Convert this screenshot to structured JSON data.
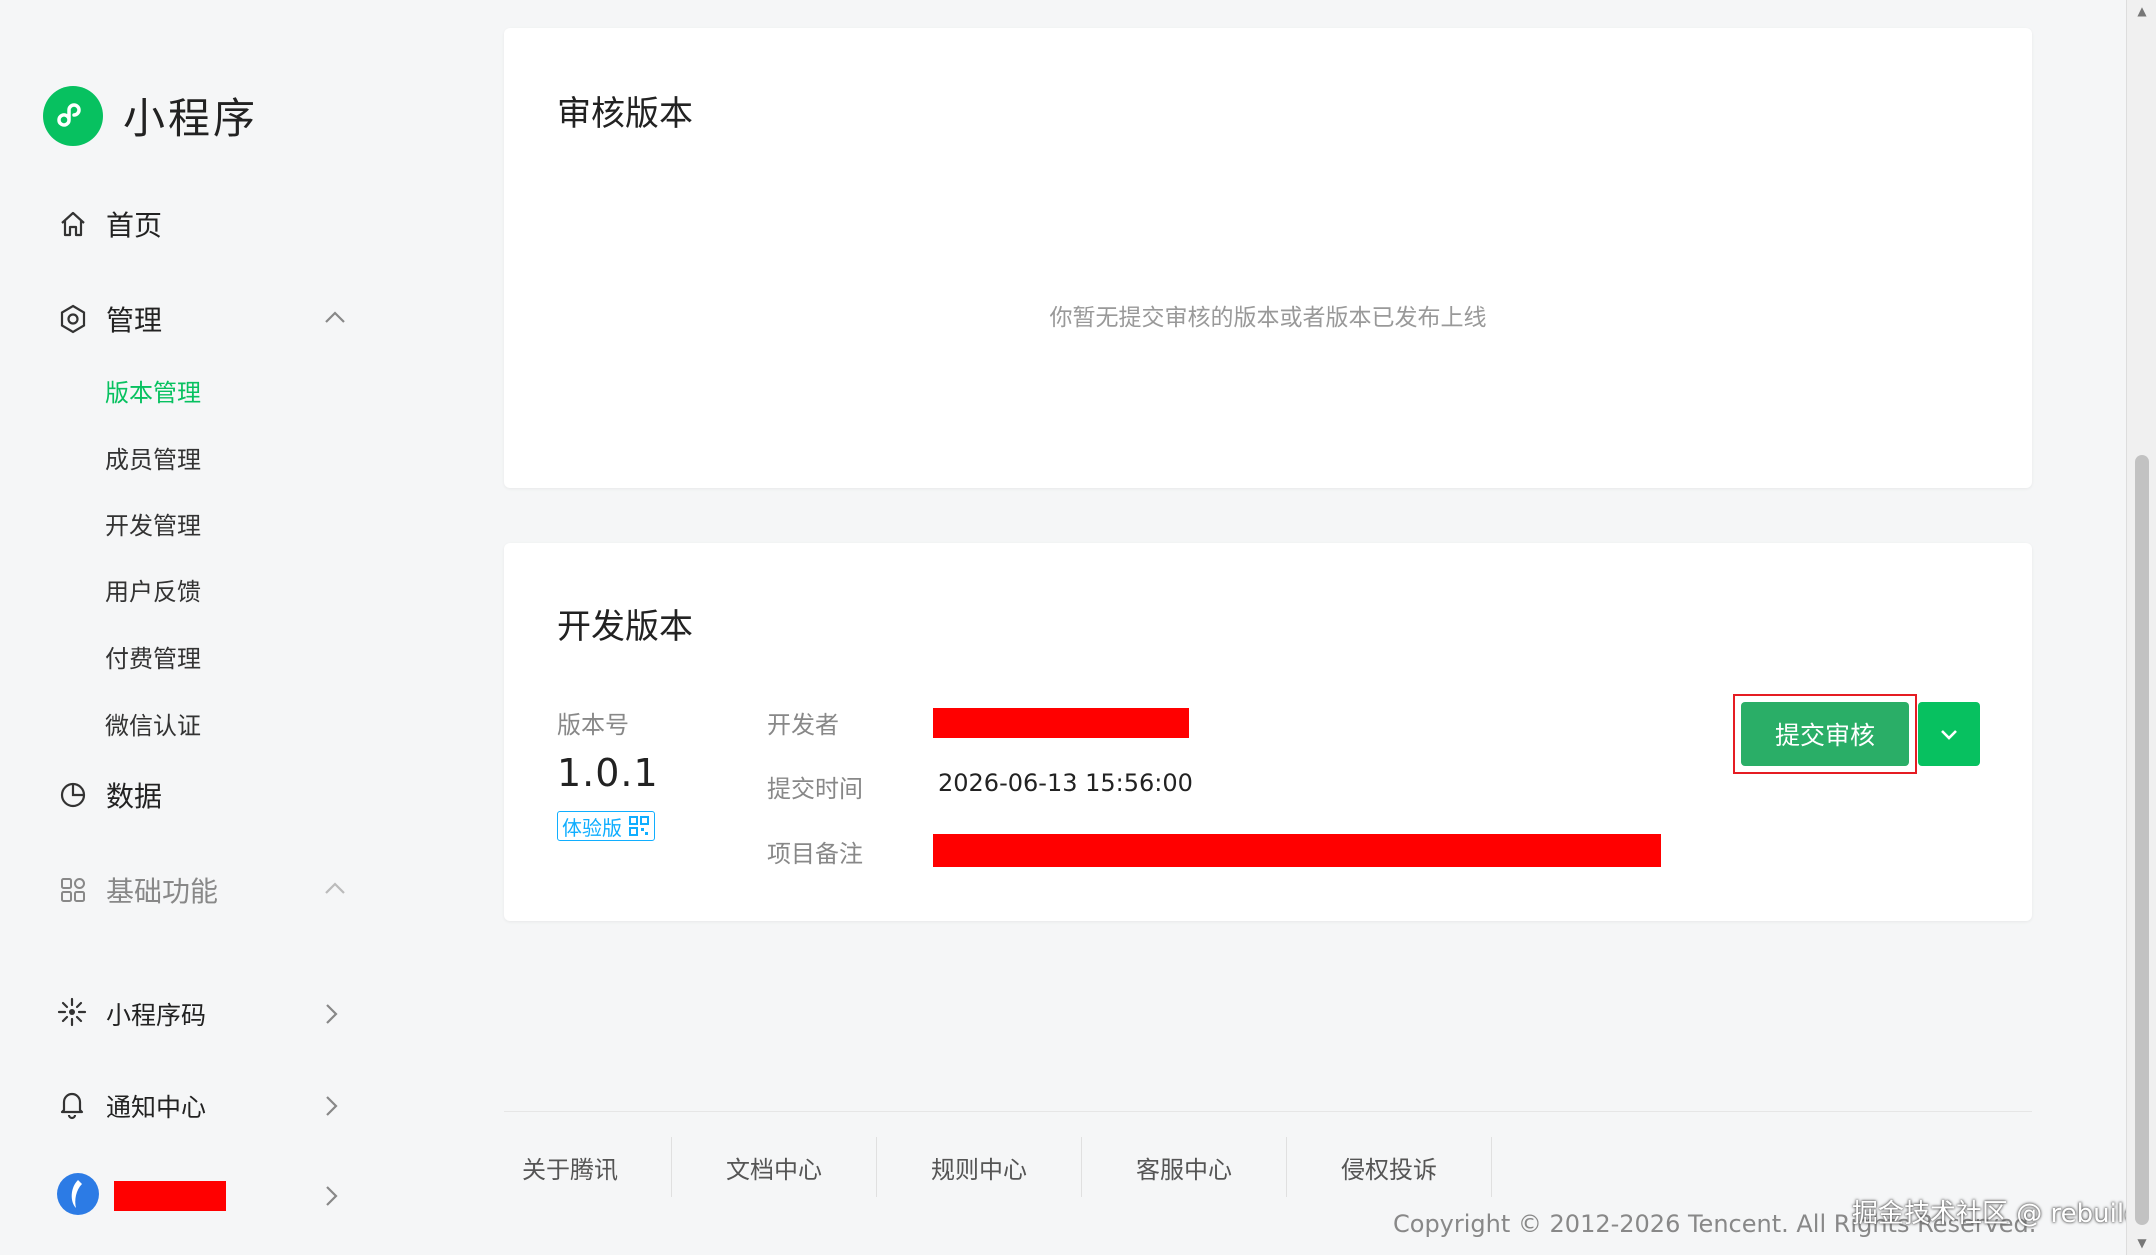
{
  "brand": {
    "title": "小程序"
  },
  "nav": {
    "home": "首页",
    "manage": "管理",
    "manage_sub": [
      "版本管理",
      "成员管理",
      "开发管理",
      "用户反馈",
      "付费管理",
      "微信认证"
    ],
    "data": "数据",
    "basic": "基础功能"
  },
  "bottom_nav": {
    "qrcode": "小程序码",
    "notify": "通知中心"
  },
  "review_card": {
    "title": "审核版本",
    "empty": "你暂无提交审核的版本或者版本已发布上线"
  },
  "dev_card": {
    "title": "开发版本",
    "version_label": "版本号",
    "version": "1.0.1",
    "tag": "体验版",
    "developer_label": "开发者",
    "time_label": "提交时间",
    "time_value": "2026-06-13 15:56:00",
    "note_label": "项目备注",
    "submit": "提交审核"
  },
  "footer": {
    "links": [
      "关于腾讯",
      "文档中心",
      "规则中心",
      "客服中心",
      "侵权投诉"
    ],
    "copyright": "Copyright © 2012-2026 Tencent. All Rights Reserved."
  },
  "watermark": "掘金技术社区 @ rebuild",
  "colors": {
    "accent": "#07c160",
    "submit": "#2aae67",
    "tag": "#10aeff",
    "redaction": "#ff0000"
  }
}
